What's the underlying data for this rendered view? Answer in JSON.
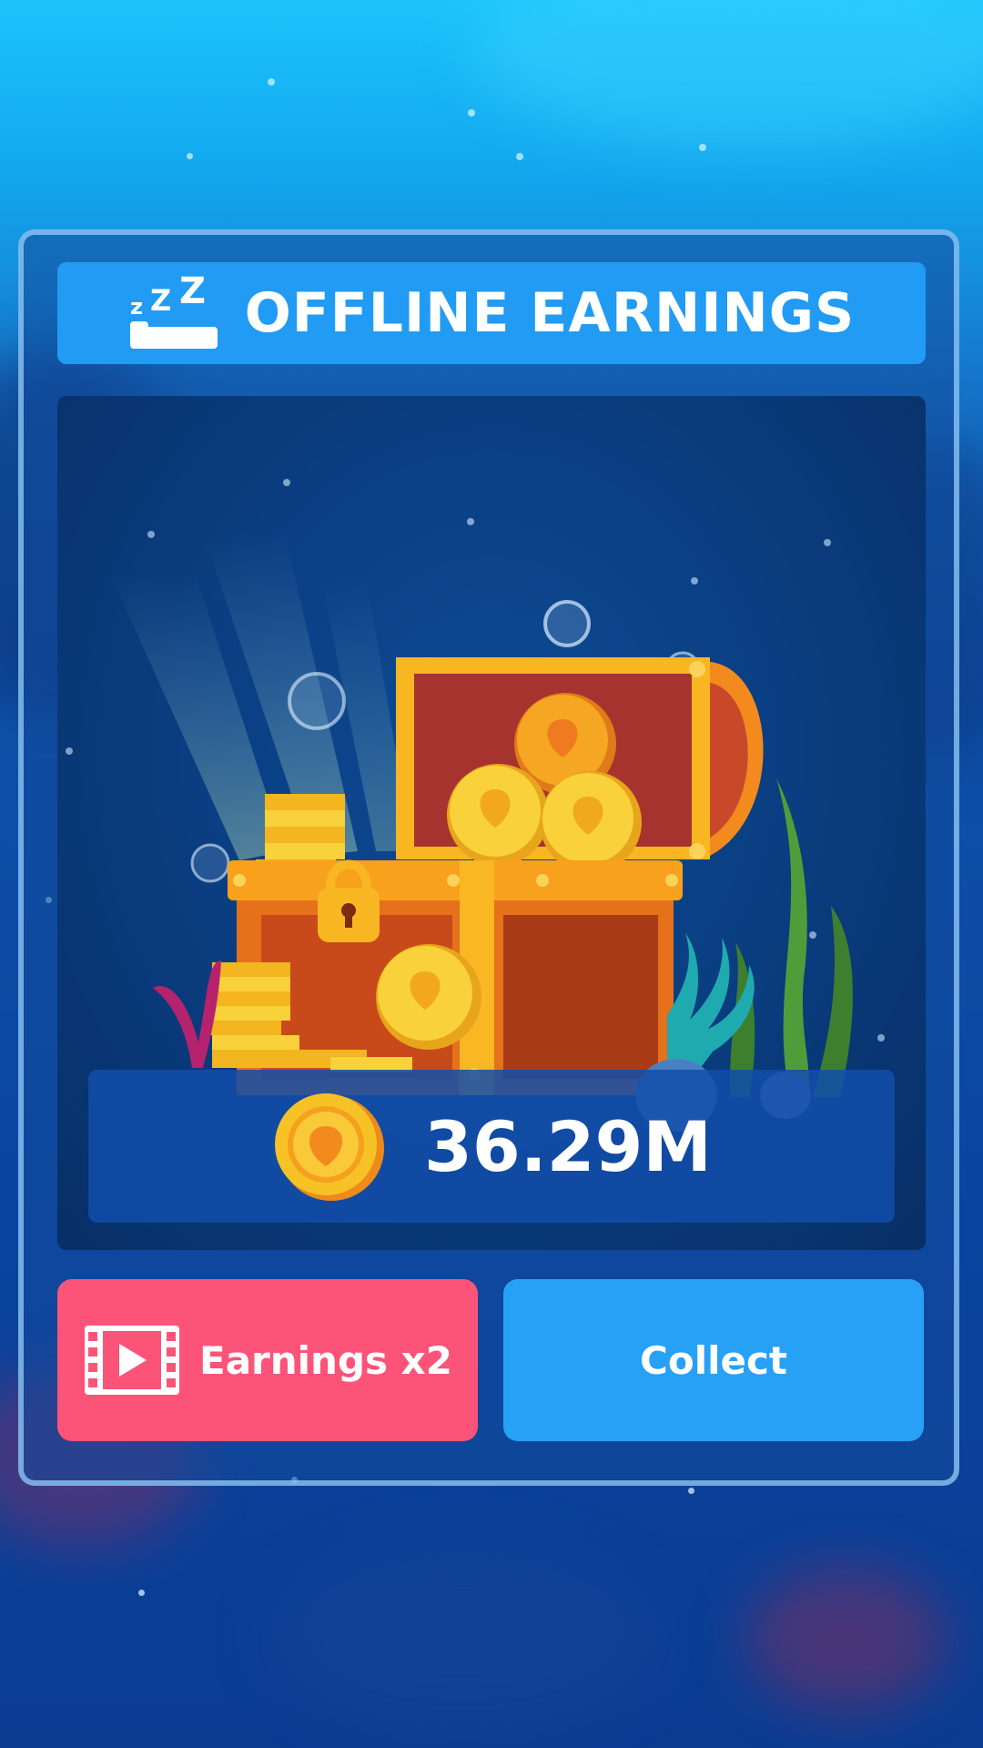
{
  "dialog": {
    "title": "OFFLINE EARNINGS",
    "icon": "sleep-zzz-icon"
  },
  "reward": {
    "amount": "36.29M",
    "icon": "coin-icon"
  },
  "buttons": {
    "double_label": "Earnings x2",
    "double_icon": "video-ad-icon",
    "collect_label": "Collect"
  },
  "colors": {
    "header": "#219bf3",
    "double_button": "#fb5478",
    "collect_button": "#27a1f6",
    "coin": "#f7c226"
  }
}
